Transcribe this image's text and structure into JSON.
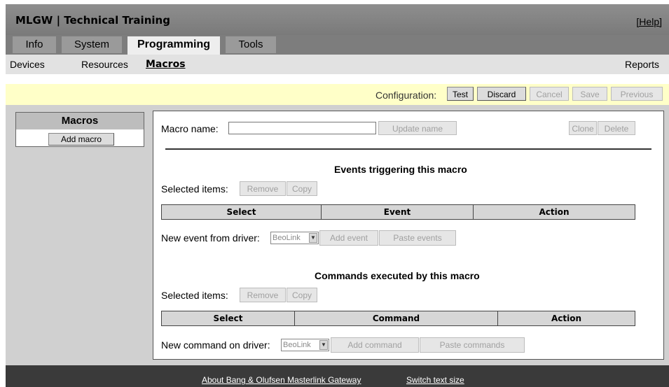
{
  "app": {
    "title": "MLGW | Technical Training",
    "help": "[Help]"
  },
  "tabs": [
    {
      "label": "Info"
    },
    {
      "label": "System"
    },
    {
      "label": "Programming"
    },
    {
      "label": "Tools"
    }
  ],
  "subnav": {
    "devices": "Devices",
    "resources": "Resources",
    "macros": "Macros",
    "reports": "Reports"
  },
  "config": {
    "label": "Configuration:",
    "test": "Test",
    "discard": "Discard",
    "cancel": "Cancel",
    "save": "Save",
    "previous": "Previous"
  },
  "left_panel": {
    "title": "Macros",
    "add_macro": "Add macro"
  },
  "macro": {
    "name_label": "Macro name:",
    "name_value": "",
    "update_name": "Update name",
    "clone": "Clone",
    "delete": "Delete"
  },
  "events": {
    "title": "Events triggering this macro",
    "selected_label": "Selected items:",
    "remove": "Remove",
    "copy": "Copy",
    "columns": [
      "Select",
      "Event",
      "Action"
    ],
    "new_label": "New event from driver:",
    "driver": "BeoLink",
    "add": "Add event",
    "paste": "Paste events"
  },
  "commands": {
    "title": "Commands executed by this macro",
    "selected_label": "Selected items:",
    "remove": "Remove",
    "copy": "Copy",
    "columns": [
      "Select",
      "Command",
      "Action"
    ],
    "new_label": "New command on driver:",
    "driver": "BeoLink",
    "add": "Add command",
    "paste": "Paste commands"
  },
  "footer": {
    "about": "About Bang & Olufsen Masterlink Gateway",
    "switch": "Switch text size"
  }
}
